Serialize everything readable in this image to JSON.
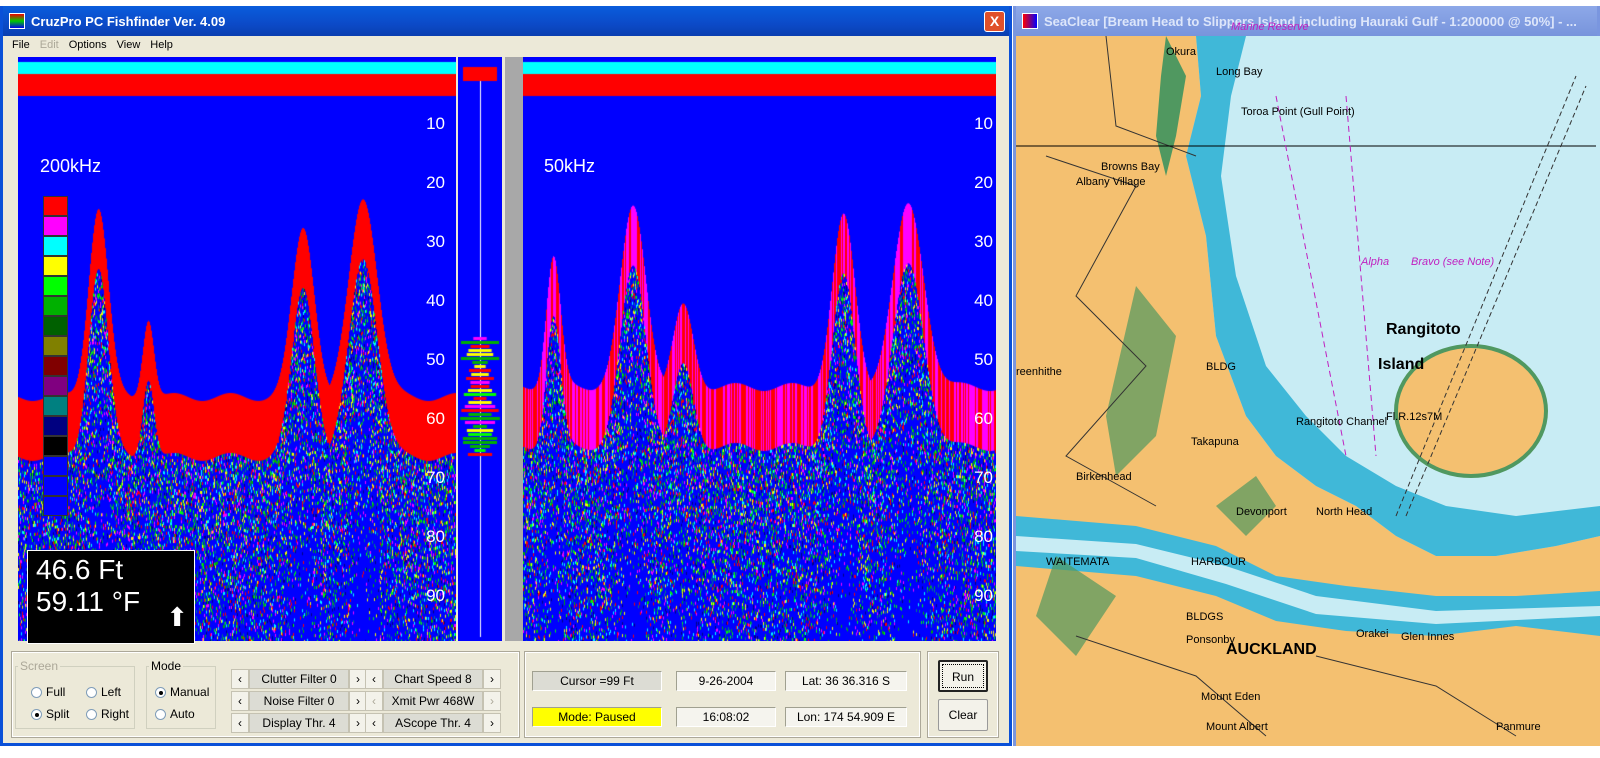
{
  "fishfinder": {
    "title": "CruzPro PC Fishfinder Ver.  4.09",
    "close_label": "X",
    "menu": [
      {
        "label": "File",
        "enabled": true
      },
      {
        "label": "Edit",
        "enabled": false
      },
      {
        "label": "Options",
        "enabled": true
      },
      {
        "label": "View",
        "enabled": true
      },
      {
        "label": "Help",
        "enabled": true
      }
    ],
    "left_panel": {
      "freq": "200kHz"
    },
    "right_panel": {
      "freq": "50kHz"
    },
    "depth_ticks": [
      "10",
      "20",
      "30",
      "40",
      "50",
      "60",
      "70",
      "80",
      "90"
    ],
    "readout": {
      "depth": "46.6 Ft",
      "temp": "59.11 °F"
    },
    "color_scale": [
      "#ff0000",
      "#ff00ff",
      "#00ffff",
      "#ffff00",
      "#00ff00",
      "#00b000",
      "#006000",
      "#808000",
      "#800000",
      "#800080",
      "#008080",
      "#000080",
      "#000000",
      "#0000ff",
      "#0000ff",
      "#0000ff"
    ],
    "screen": {
      "legend": "Screen",
      "options": [
        {
          "label": "Full",
          "checked": false
        },
        {
          "label": "Left",
          "checked": false
        },
        {
          "label": "Split",
          "checked": true
        },
        {
          "label": "Right",
          "checked": false
        }
      ]
    },
    "mode": {
      "legend": "Mode",
      "options": [
        {
          "label": "Manual",
          "checked": true
        },
        {
          "label": "Auto",
          "checked": false
        }
      ]
    },
    "steppers": [
      {
        "label": "Clutter Filter 0",
        "enabled": true
      },
      {
        "label": "Noise Filter 0",
        "enabled": true
      },
      {
        "label": "Display Thr. 4",
        "enabled": true
      },
      {
        "label": "Chart Speed 8",
        "enabled": true
      },
      {
        "label": "Xmit Pwr 468W",
        "enabled": false
      },
      {
        "label": "AScope Thr. 4",
        "enabled": true
      }
    ],
    "status": {
      "cursor": "Cursor =99 Ft",
      "mode": "Mode: Paused",
      "date": "9-26-2004",
      "time": "16:08:02",
      "lat": "Lat: 36  36.316 S",
      "lon": "Lon: 174  54.909 E"
    },
    "buttons": {
      "run": "Run",
      "clear": "Clear"
    },
    "colors": {
      "sonar_bg": "#0000ff",
      "mode_paused": "#ffff00"
    }
  },
  "seaclear": {
    "title": "SeaClear [Bream Head to Slippers Island including Hauraki Gulf - 1:200000 @ 50%] - ...",
    "labels": [
      {
        "t": "Okura",
        "c": ""
      },
      {
        "t": "Long Bay",
        "c": ""
      },
      {
        "t": "Toroa Point (Gull Point)",
        "c": ""
      },
      {
        "t": "Browns Bay",
        "c": ""
      },
      {
        "t": "Albany Village",
        "c": ""
      },
      {
        "t": "Marine Reserve",
        "c": "mag"
      },
      {
        "t": "Alpha",
        "c": "mag"
      },
      {
        "t": "Bravo (see Note)",
        "c": "mag"
      },
      {
        "t": "Rangitoto",
        "c": "big"
      },
      {
        "t": "Island",
        "c": "big"
      },
      {
        "t": "Fl.R.12s7M",
        "c": ""
      },
      {
        "t": "reenhithe",
        "c": ""
      },
      {
        "t": "BLDG",
        "c": ""
      },
      {
        "t": "Takapuna",
        "c": ""
      },
      {
        "t": "Birkenhead",
        "c": ""
      },
      {
        "t": "Devonport",
        "c": ""
      },
      {
        "t": "North Head",
        "c": ""
      },
      {
        "t": "Rangitoto Channel",
        "c": ""
      },
      {
        "t": "WAITEMATA",
        "c": ""
      },
      {
        "t": "HARBOUR",
        "c": ""
      },
      {
        "t": "BLDGS",
        "c": ""
      },
      {
        "t": "Ponsonby",
        "c": ""
      },
      {
        "t": "Orakei",
        "c": ""
      },
      {
        "t": "Glen Innes",
        "c": ""
      },
      {
        "t": "AUCKLAND",
        "c": "big"
      },
      {
        "t": "Mount Eden",
        "c": ""
      },
      {
        "t": "Mount Albert",
        "c": ""
      },
      {
        "t": "Panmure",
        "c": ""
      }
    ],
    "colors": {
      "water": "#c8ecf4",
      "land": "#f4c070",
      "shallow": "#40b8d8",
      "green": "#509860"
    }
  }
}
